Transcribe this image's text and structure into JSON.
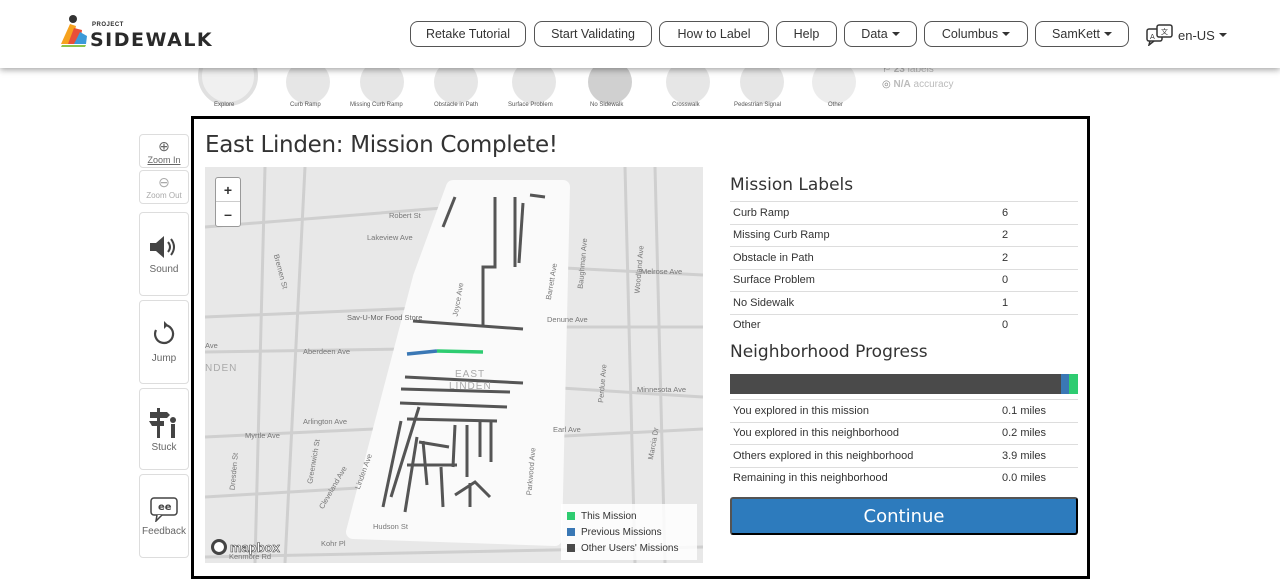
{
  "header": {
    "logo_small": "PROJECT",
    "logo_big": "SIDEWALK",
    "buttons": [
      "Retake Tutorial",
      "Start Validating",
      "How to Label",
      "Help"
    ],
    "dropdowns": [
      "Data",
      "Columbus",
      "SamKett"
    ],
    "language": "en-US"
  },
  "background": {
    "label_types": [
      "Explore",
      "Curb Ramp",
      "Missing Curb Ramp",
      "Obstacle in Path",
      "Surface Problem",
      "No Sidewalk",
      "Crosswalk",
      "Pedestrian Signal",
      "Other"
    ],
    "labels_count": "23",
    "labels_text": "labels",
    "accuracy_value": "N/A",
    "accuracy_text": "accuracy"
  },
  "toolbar": {
    "zoom_in": "Zoom In",
    "zoom_out": "Zoom Out",
    "sound": "Sound",
    "jump": "Jump",
    "stuck": "Stuck",
    "feedback": "Feedback"
  },
  "modal": {
    "title": "East Linden: Mission Complete!",
    "map_labels": [
      "Robert St",
      "Lakeview Ave",
      "Bremen St",
      "Sav-U-Mor Food Store",
      "Joyce Ave",
      "Aberdeen Ave",
      "EAST",
      "LINDEN",
      "Arlington Ave",
      "Myrtle Ave",
      "Earl Ave",
      "Hudson St",
      "Kohr Pl",
      "Kenmore Rd",
      "Denune Ave",
      "Melrose Ave",
      "Minnesota Ave",
      "Perdue Ave",
      "Baughman Ave",
      "Woodland Ave",
      "Barrett Ave",
      "Parkwood Ave",
      "Cleveland Ave",
      "Linden Ave",
      "Greenwich St",
      "Dresden St",
      "NDEN",
      "Ave",
      "Marcia Dr"
    ],
    "zoom_plus": "+",
    "zoom_minus": "–",
    "mapbox": "mapbox",
    "legend": [
      {
        "label": "This Mission",
        "color": "#2ecc71"
      },
      {
        "label": "Previous Missions",
        "color": "#3a78b5"
      },
      {
        "label": "Other Users' Missions",
        "color": "#4a4a4a"
      }
    ],
    "mission_labels_title": "Mission Labels",
    "mission_labels": [
      {
        "name": "Curb Ramp",
        "value": "6"
      },
      {
        "name": "Missing Curb Ramp",
        "value": "2"
      },
      {
        "name": "Obstacle in Path",
        "value": "2"
      },
      {
        "name": "Surface Problem",
        "value": "0"
      },
      {
        "name": "No Sidewalk",
        "value": "1"
      },
      {
        "name": "Other",
        "value": "0"
      }
    ],
    "progress_title": "Neighborhood Progress",
    "progress": {
      "other_users": 0.95,
      "previous": 0.025,
      "this_mission": 0.025
    },
    "progress_stats": [
      {
        "name": "You explored in this mission",
        "value": "0.1 miles"
      },
      {
        "name": "You explored in this neighborhood",
        "value": "0.2 miles"
      },
      {
        "name": "Others explored in this neighborhood",
        "value": "3.9 miles"
      },
      {
        "name": "Remaining in this neighborhood",
        "value": "0.0 miles"
      }
    ],
    "continue_label": "Continue"
  },
  "colors": {
    "accent": "#2d7bbd",
    "this_mission": "#2ecc71",
    "previous": "#3a78b5",
    "others": "#4a4a4a"
  }
}
